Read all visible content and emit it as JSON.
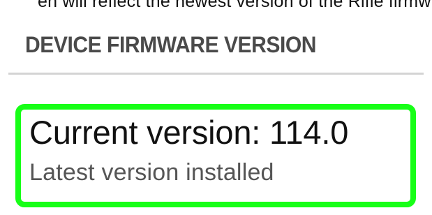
{
  "intro": {
    "text": "en will reflect the newest version of the Rifle firmw"
  },
  "section": {
    "title": "DEVICE FIRMWARE VERSION"
  },
  "firmware": {
    "current_version_text": "Current version: 114.0",
    "status_text": "Latest version installed"
  },
  "colors": {
    "highlight_border": "#17ff17",
    "header_text": "#4a4a4a",
    "divider": "#d4d4d4",
    "primary_text": "#111111",
    "secondary_text": "#555555",
    "background": "#ffffff"
  }
}
